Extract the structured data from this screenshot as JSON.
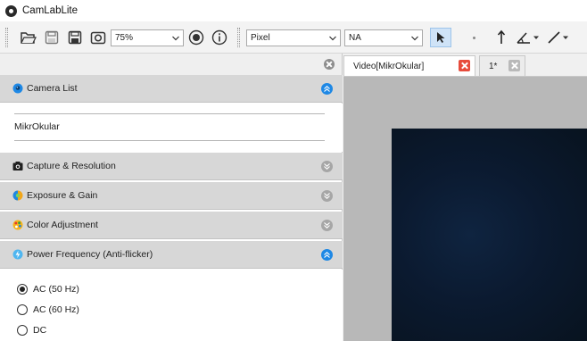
{
  "app": {
    "title": "CamLabLite"
  },
  "toolbar": {
    "zoom_value": "75%",
    "unit_value": "Pixel",
    "calibration_value": "NA",
    "icons": [
      "open-folder-icon",
      "save-icon",
      "save-as-icon",
      "snapshot-icon",
      "fit-icon",
      "info-icon",
      "pointer-icon",
      "point-icon",
      "arrow-up-icon",
      "angle-icon",
      "line-icon"
    ]
  },
  "left_panel": {
    "sections": [
      {
        "title": "Camera List",
        "icon": "webcam-icon",
        "expanded": true
      },
      {
        "title": "Capture & Resolution",
        "icon": "camera-icon",
        "expanded": false
      },
      {
        "title": "Exposure & Gain",
        "icon": "exposure-icon",
        "expanded": false
      },
      {
        "title": "Color Adjustment",
        "icon": "palette-icon",
        "expanded": false
      },
      {
        "title": "Power Frequency (Anti-flicker)",
        "icon": "power-icon",
        "expanded": true
      }
    ],
    "camera_list": {
      "items": [
        "MikrOkular"
      ]
    },
    "power_frequency": {
      "options": [
        "AC (50 Hz)",
        "AC (60 Hz)",
        "DC"
      ],
      "selected": "AC (50 Hz)"
    }
  },
  "tabs": [
    {
      "label": "Video[MikrOkular]",
      "active": true
    },
    {
      "label": "1*",
      "active": false
    }
  ],
  "colors": {
    "accent": "#1e88e5",
    "tab_close_active": "#e74c3c",
    "section_header": "#d7d7d7",
    "video_background": "#0b1a30"
  }
}
